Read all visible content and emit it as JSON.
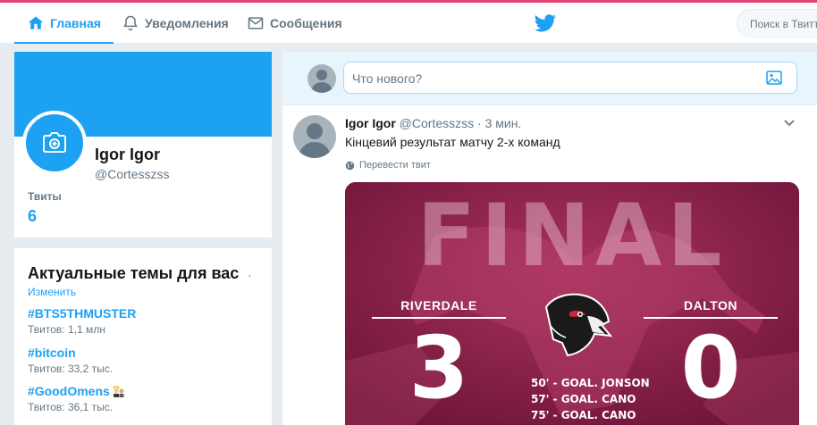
{
  "nav": {
    "home": "Главная",
    "notifications": "Уведомления",
    "messages": "Сообщения",
    "search_placeholder": "Поиск в Твиттере"
  },
  "profile": {
    "name": "Igor Igor",
    "handle": "@Cortesszss",
    "tweets_label": "Твиты",
    "tweets_count": "6"
  },
  "trends": {
    "title": "Актуальные темы для вас",
    "dot": "·",
    "change": "Изменить",
    "items": [
      {
        "name": "#BTS5THMUSTER",
        "count": "Твитов: 1,1 млн"
      },
      {
        "name": "#bitcoin",
        "count": "Твитов: 33,2 тыс."
      },
      {
        "name": "#GoodOmens",
        "count": "Твитов: 36,1 тыс."
      }
    ]
  },
  "compose": {
    "placeholder": "Что нового?"
  },
  "tweet": {
    "name": "Igor Igor",
    "handle": "@Cortesszss",
    "time": "3 мин.",
    "text": "Кінцевий результат матчу 2-х команд",
    "translate": "Перевести твит",
    "media": {
      "headline": "FINAL",
      "home_team": "RIVERDALE",
      "away_team": "DALTON",
      "home_score": "3",
      "away_score": "0",
      "goals": [
        "50' - GOAL. JONSON",
        "57' - GOAL. CANO",
        "75' - GOAL. CANO"
      ]
    }
  },
  "colors": {
    "accent": "#1da1f2",
    "media_bg": "#8a1a47"
  }
}
